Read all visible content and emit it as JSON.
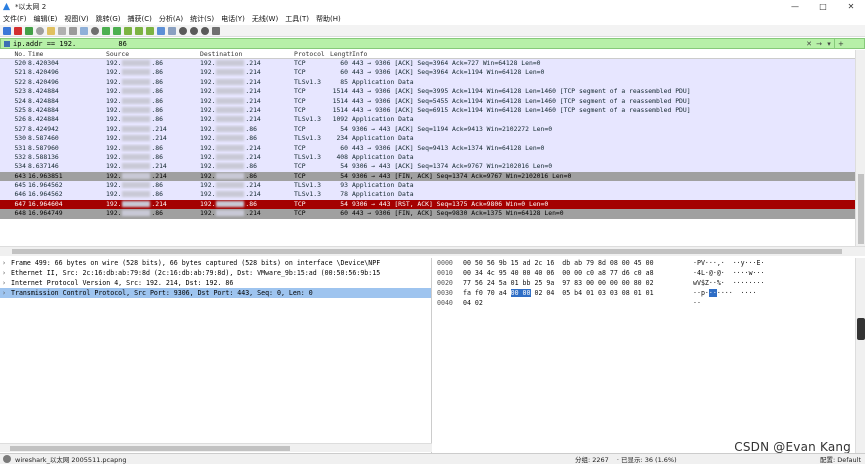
{
  "window": {
    "title": "*以太网 2",
    "min": "—",
    "max": "□",
    "close": "✕"
  },
  "menu": [
    "文件(F)",
    "编辑(E)",
    "视图(V)",
    "跳转(G)",
    "捕获(C)",
    "分析(A)",
    "统计(S)",
    "电话(Y)",
    "无线(W)",
    "工具(T)",
    "帮助(H)"
  ],
  "filter": {
    "text": "ip.addr == 192.          86",
    "clear": "✕",
    "arrow": "→",
    "dropdown": "▾",
    "expr": "+"
  },
  "columns": [
    "No.",
    "Time",
    "Source",
    "Destination",
    "Protocol",
    "Length",
    "Info"
  ],
  "packets": [
    {
      "no": "520",
      "time": "8.420304",
      "src_a": "192.",
      "src_b": ".86",
      "dst_a": "192.",
      "dst_b": ".214",
      "proto": "TCP",
      "len": "60",
      "info": "443 → 9306 [ACK] Seq=3964 Ack=727 Win=64128 Len=0",
      "style": "normal"
    },
    {
      "no": "521",
      "time": "8.420496",
      "src_a": "192.",
      "src_b": ".86",
      "dst_a": "192.",
      "dst_b": ".214",
      "proto": "TCP",
      "len": "60",
      "info": "443 → 9306 [ACK] Seq=3964 Ack=1194 Win=64128 Len=0",
      "style": "normal"
    },
    {
      "no": "522",
      "time": "8.420496",
      "src_a": "192.",
      "src_b": ".86",
      "dst_a": "192.",
      "dst_b": ".214",
      "proto": "TLSv1.3",
      "len": "85",
      "info": "Application Data",
      "style": "normal"
    },
    {
      "no": "523",
      "time": "8.424884",
      "src_a": "192.",
      "src_b": ".86",
      "dst_a": "192.",
      "dst_b": ".214",
      "proto": "TCP",
      "len": "1514",
      "info": "443 → 9306 [ACK] Seq=3995 Ack=1194 Win=64128 Len=1460 [TCP segment of a reassembled PDU]",
      "style": "normal"
    },
    {
      "no": "524",
      "time": "8.424884",
      "src_a": "192.",
      "src_b": ".86",
      "dst_a": "192.",
      "dst_b": ".214",
      "proto": "TCP",
      "len": "1514",
      "info": "443 → 9306 [ACK] Seq=5455 Ack=1194 Win=64128 Len=1460 [TCP segment of a reassembled PDU]",
      "style": "normal"
    },
    {
      "no": "525",
      "time": "8.424884",
      "src_a": "192.",
      "src_b": ".86",
      "dst_a": "192.",
      "dst_b": ".214",
      "proto": "TCP",
      "len": "1514",
      "info": "443 → 9306 [ACK] Seq=6915 Ack=1194 Win=64128 Len=1460 [TCP segment of a reassembled PDU]",
      "style": "normal"
    },
    {
      "no": "526",
      "time": "8.424884",
      "src_a": "192.",
      "src_b": ".86",
      "dst_a": "192.",
      "dst_b": ".214",
      "proto": "TLSv1.3",
      "len": "1092",
      "info": "Application Data",
      "style": "normal"
    },
    {
      "no": "527",
      "time": "8.424942",
      "src_a": "192.",
      "src_b": ".214",
      "dst_a": "192.",
      "dst_b": ".86",
      "proto": "TCP",
      "len": "54",
      "info": "9306 → 443 [ACK] Seq=1194 Ack=9413 Win=2102272 Len=0",
      "style": "normal"
    },
    {
      "no": "530",
      "time": "8.587460",
      "src_a": "192.",
      "src_b": ".214",
      "dst_a": "192.",
      "dst_b": ".86",
      "proto": "TLSv1.3",
      "len": "234",
      "info": "Application Data",
      "style": "normal"
    },
    {
      "no": "531",
      "time": "8.587960",
      "src_a": "192.",
      "src_b": ".86",
      "dst_a": "192.",
      "dst_b": ".214",
      "proto": "TCP",
      "len": "60",
      "info": "443 → 9306 [ACK] Seq=9413 Ack=1374 Win=64128 Len=0",
      "style": "normal"
    },
    {
      "no": "532",
      "time": "8.588136",
      "src_a": "192.",
      "src_b": ".86",
      "dst_a": "192.",
      "dst_b": ".214",
      "proto": "TLSv1.3",
      "len": "408",
      "info": "Application Data",
      "style": "normal"
    },
    {
      "no": "534",
      "time": "8.637146",
      "src_a": "192.",
      "src_b": ".214",
      "dst_a": "192.",
      "dst_b": ".86",
      "proto": "TCP",
      "len": "54",
      "info": "9306 → 443 [ACK] Seq=1374 Ack=9767 Win=2102016 Len=0",
      "style": "normal"
    },
    {
      "no": "643",
      "time": "16.963851",
      "src_a": "192.",
      "src_b": ".214",
      "dst_a": "192.",
      "dst_b": ".86",
      "proto": "TCP",
      "len": "54",
      "info": "9306 → 443 [FIN, ACK] Seq=1374 Ack=9767 Win=2102016 Len=0",
      "style": "dark"
    },
    {
      "no": "645",
      "time": "16.964562",
      "src_a": "192.",
      "src_b": ".86",
      "dst_a": "192.",
      "dst_b": ".214",
      "proto": "TLSv1.3",
      "len": "93",
      "info": "Application Data",
      "style": "normal"
    },
    {
      "no": "646",
      "time": "16.964562",
      "src_a": "192.",
      "src_b": ".86",
      "dst_a": "192.",
      "dst_b": ".214",
      "proto": "TLSv1.3",
      "len": "78",
      "info": "Application Data",
      "style": "normal"
    },
    {
      "no": "647",
      "time": "16.964604",
      "src_a": "192.",
      "src_b": ".214",
      "dst_a": "192.",
      "dst_b": ".86",
      "proto": "TCP",
      "len": "54",
      "info": "9306 → 443 [RST, ACK] Seq=1375 Ack=9806 Win=0 Len=0",
      "style": "selected"
    },
    {
      "no": "648",
      "time": "16.964749",
      "src_a": "192.",
      "src_b": ".86",
      "dst_a": "192.",
      "dst_b": ".214",
      "proto": "TCP",
      "len": "60",
      "info": "443 → 9306 [FIN, ACK] Seq=9830 Ack=1375 Win=64128 Len=0",
      "style": "gray"
    }
  ],
  "details": [
    {
      "text": "Frame 499: 66 bytes on wire (528 bits), 66 bytes captured (528 bits) on interface \\Device\\NPF",
      "selected": false
    },
    {
      "text": "Ethernet II, Src: 2c:16:db:ab:79:8d (2c:16:db:ab:79:8d), Dst: VMware_9b:15:ad (00:50:56:9b:15",
      "selected": false
    },
    {
      "text": "Internet Protocol Version 4, Src: 192.          214, Dst: 192.           86",
      "selected": false
    },
    {
      "text": "Transmission Control Protocol, Src Port: 9306, Dst Port: 443, Seq: 0, Len: 0",
      "selected": true
    }
  ],
  "bytes": [
    {
      "off": "0000",
      "hex": "00 50 56 9b 15 ad 2c 16  db ab 79 8d 08 00 45 00",
      "asc": "·PV···,·  ··y···E·"
    },
    {
      "off": "0010",
      "hex": "00 34 4c 95 40 00 40 06  00 00 c0 a8 77 d6 c0 a8",
      "asc": "·4L·@·@·  ····w···"
    },
    {
      "off": "0020",
      "hex": "77 56 24 5a 01 bb 25 9a  97 83 00 00 00 00 80 02",
      "asc": "wV$Z··%·  ········"
    },
    {
      "off": "0030",
      "hex_pre": "fa f0 70 a4 ",
      "hex_hl": "00 00",
      "hex_post": " 02 04  05 b4 01 03 03 08 01 01",
      "asc_pre": "··p·",
      "asc_hl": "··",
      "asc_post": "····  ····"
    },
    {
      "off": "0040",
      "hex": "04 02",
      "asc": "··"
    }
  ],
  "status": {
    "file": "wireshark_以太网 2005511.pcapng",
    "packets": "分组: 2267",
    "displayed": "· 已显示: 36 (1.6%)",
    "profile": "配置: Default"
  },
  "watermark": "CSDN @Evan Kang",
  "colors": {
    "filter_bg": "#b7f0a8",
    "row_bg": "#e7e6ff",
    "selected_row": "#a40000",
    "fin_row": "#a0a0a0",
    "detail_selected": "#9ec4ef"
  }
}
